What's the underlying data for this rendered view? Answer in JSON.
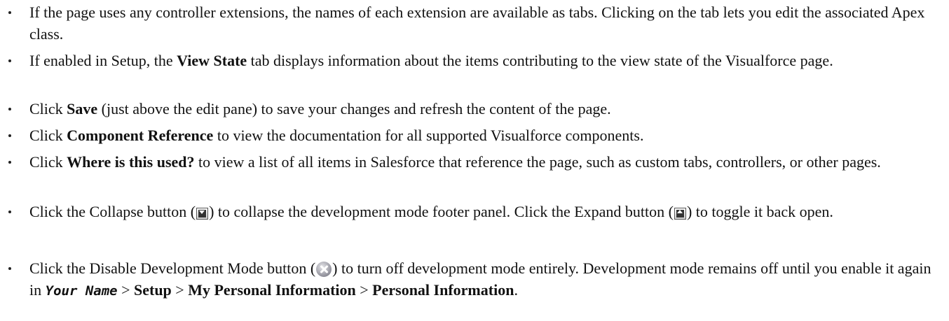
{
  "bullets": [
    {
      "pre": "If the page uses any controller extensions, the names of each extension are available as tabs. Clicking on the tab lets you edit the associated Apex class."
    },
    {
      "pre": "If enabled in Setup, the ",
      "bold": "View State",
      "post": " tab displays information about the items contributing to the view state of the Visualforce page."
    },
    {
      "pre": "Click ",
      "bold": "Save",
      "post": " (just above the edit pane) to save your changes and refresh the content of the page."
    },
    {
      "pre": "Click ",
      "bold": "Component Reference",
      "post": " to view the documentation for all supported Visualforce components."
    },
    {
      "pre": "Click ",
      "bold": "Where is this used?",
      "post": " to view a list of all items in Salesforce that reference the page, such as custom tabs, controllers, or other pages."
    },
    {
      "pre": "Click the Collapse button (",
      "mid1": ") to collapse the development mode footer panel. Click the Expand button (",
      "post": ") to toggle it back open.",
      "icon1": "collapse-icon",
      "icon2": "expand-icon"
    },
    {
      "pre": "Click the Disable Development Mode button (",
      "mid1": ") to turn off development mode entirely. Development mode remains off until you enable it again in ",
      "code": "Your Name",
      "sep1": " > ",
      "bold1": "Setup",
      "sep2": " > ",
      "bold2": "My Personal Information",
      "sep3": " > ",
      "bold3": "Personal Information",
      "end": ".",
      "icon": "disable-icon"
    }
  ]
}
